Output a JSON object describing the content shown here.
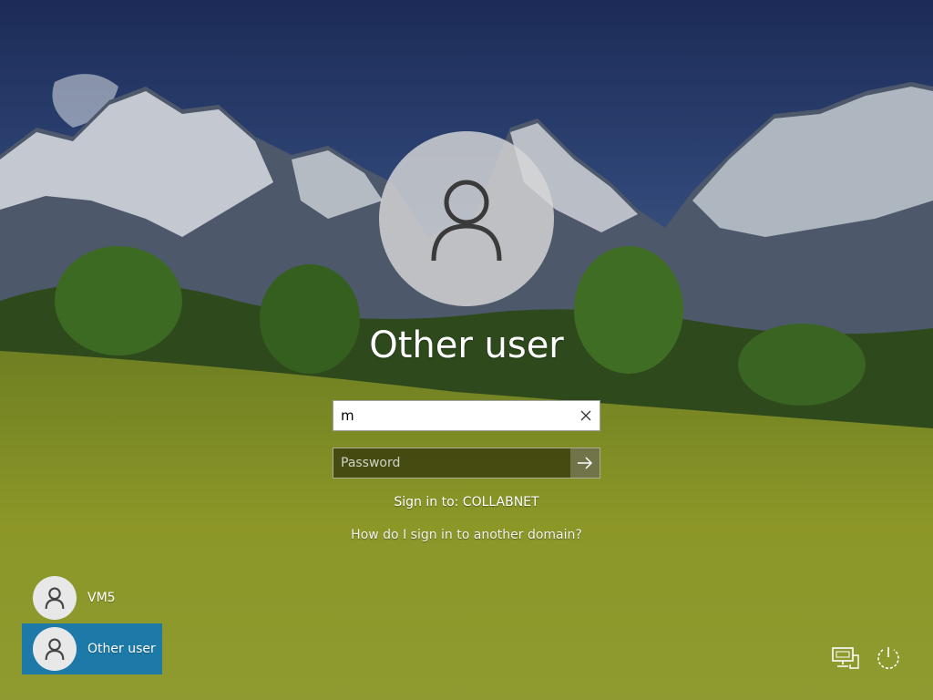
{
  "window": {
    "title": "Other user"
  },
  "login": {
    "username_value": "m",
    "password_placeholder": "Password",
    "sign_in_to": "Sign in to: COLLABNET",
    "domain_help_link": "How do I sign in to another domain?"
  },
  "users": [
    {
      "name": "VM5",
      "selected": false
    },
    {
      "name": "Other user",
      "selected": true
    }
  ],
  "icons": {
    "clear": "close-icon",
    "submit": "arrow-right-icon",
    "avatar": "user-icon",
    "network": "network-icon",
    "power": "power-icon"
  },
  "colors": {
    "selected_user_bg": "#1d7aa8",
    "text": "#ffffff"
  }
}
